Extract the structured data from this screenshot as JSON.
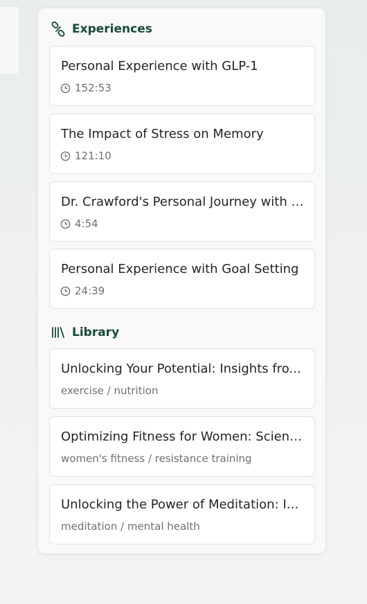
{
  "experiences": {
    "title": "Experiences",
    "items": [
      {
        "title": "Personal Experience with GLP-1",
        "duration": "152:53"
      },
      {
        "title": "The Impact of Stress on Memory",
        "duration": "121:10"
      },
      {
        "title": "Dr. Crawford's Personal Journey with I...",
        "duration": "4:54"
      },
      {
        "title": "Personal Experience with Goal Setting",
        "duration": "24:39"
      }
    ]
  },
  "library": {
    "title": "Library",
    "items": [
      {
        "title": "Unlocking Your Potential: Insights fro...",
        "tags": "exercise / nutrition"
      },
      {
        "title": "Optimizing Fitness for Women: Scienc...",
        "tags": "women's fitness / resistance training"
      },
      {
        "title": "Unlocking the Power of Meditation: In...",
        "tags": "meditation / mental health"
      }
    ]
  },
  "colors": {
    "accent": "#164a38",
    "text": "#1f2421",
    "muted": "#6b716d"
  },
  "icons": {
    "experiences": "link-icon",
    "library": "library-icon",
    "duration": "clock-icon"
  }
}
